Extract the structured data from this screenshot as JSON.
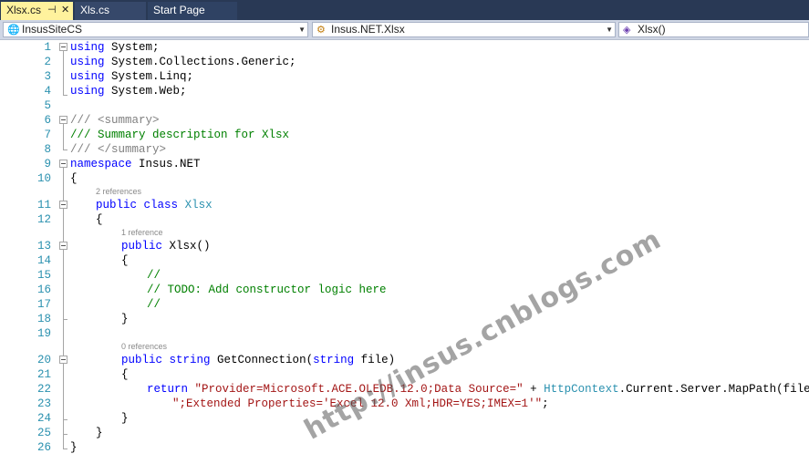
{
  "tabs": [
    {
      "label": "Xlsx.cs",
      "pin_glyph": "⊣",
      "close_glyph": "✕"
    },
    {
      "label": "Xls.cs"
    },
    {
      "label": "Start Page"
    }
  ],
  "navbar": {
    "project": "InsusSiteCS",
    "type": "Insus.NET.Xlsx",
    "member": "Xlsx()"
  },
  "editor": {
    "line_numbers": [
      "1",
      "2",
      "3",
      "4",
      "5",
      "6",
      "7",
      "8",
      "9",
      "10",
      "11",
      "12",
      "13",
      "14",
      "15",
      "16",
      "17",
      "18",
      "19",
      "20",
      "21",
      "22",
      "23",
      "24",
      "25",
      "26"
    ],
    "lens": {
      "class_refs": "2 references",
      "ctor_refs": "1 reference",
      "method_refs": "0 references"
    },
    "tokens": {
      "using": "using",
      "system": " System;",
      "collections": " System.Collections.Generic;",
      "linq": " System.Linq;",
      "web": " System.Web;",
      "xml_open_slashes": "/// ",
      "xml_open_tag": "<summary>",
      "summary_text": "/// Summary description for Xlsx",
      "xml_close_slashes": "/// ",
      "xml_close_tag": "</summary>",
      "namespace_kw": "namespace",
      "namespace_name": " Insus.NET",
      "open_brace": "{",
      "close_brace": "}",
      "public_kw": "public",
      "class_kw": "class",
      "class_name": "Xlsx",
      "ctor": "Xlsx()",
      "comment_empty": "//",
      "todo": "// TODO: Add constructor logic here",
      "string_kw": "string",
      "method_name": " GetConnection(",
      "param_type": "string",
      "param_rest": " file)",
      "return_kw": "return",
      "str1": "\"Provider=Microsoft.ACE.OLEDB.12.0;Data Source=\"",
      "plus": " + ",
      "httpcontext": "HttpContext",
      "mappath": ".Current.Server.MapPath(file) +",
      "str2": "\";Extended Properties='Excel 12.0 Xml;HDR=YES;IMEX=1'\"",
      "semicolon": ";"
    }
  },
  "watermark": "http://insus.cnblogs.com"
}
